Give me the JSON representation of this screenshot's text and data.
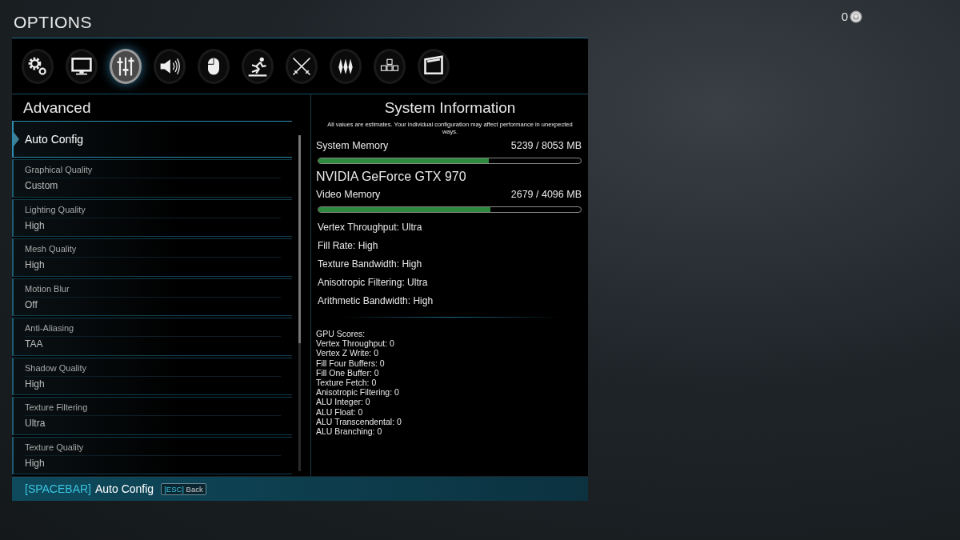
{
  "title": "OPTIONS",
  "currency": {
    "amount": "0"
  },
  "tabs": [
    {
      "kind": "gears",
      "selected": false
    },
    {
      "kind": "monitor",
      "selected": false
    },
    {
      "kind": "sliders",
      "selected": true
    },
    {
      "kind": "speaker",
      "selected": false
    },
    {
      "kind": "mouse",
      "selected": false
    },
    {
      "kind": "runner",
      "selected": false
    },
    {
      "kind": "swords",
      "selected": false
    },
    {
      "kind": "spikes",
      "selected": false
    },
    {
      "kind": "keys",
      "selected": false
    },
    {
      "kind": "screen",
      "selected": false
    }
  ],
  "settings": {
    "heading": "Advanced",
    "items": [
      {
        "kind": "action",
        "label": "Auto Config",
        "selected": true
      },
      {
        "kind": "option",
        "label": "Graphical Quality",
        "value": "Custom",
        "selected": false
      },
      {
        "kind": "option",
        "label": "Lighting Quality",
        "value": "High",
        "selected": false
      },
      {
        "kind": "option",
        "label": "Mesh Quality",
        "value": "High",
        "selected": false
      },
      {
        "kind": "option",
        "label": "Motion Blur",
        "value": "Off",
        "selected": false
      },
      {
        "kind": "option",
        "label": "Anti-Aliasing",
        "value": "TAA",
        "selected": false
      },
      {
        "kind": "option",
        "label": "Shadow Quality",
        "value": "High",
        "selected": false
      },
      {
        "kind": "option",
        "label": "Texture Filtering",
        "value": "Ultra",
        "selected": false
      },
      {
        "kind": "option",
        "label": "Texture Quality",
        "value": "High",
        "selected": false
      }
    ]
  },
  "system_info": {
    "title": "System Information",
    "note": "All values are estimates. Your individual configuration may affect performance in unexpected ways.",
    "system_memory": {
      "label": "System Memory",
      "reading": "5239 / 8053 MB",
      "level": 0.65
    },
    "gpu_name": "NVIDIA GeForce GTX 970",
    "video_memory": {
      "label": "Video Memory",
      "reading": "2679 / 4096 MB",
      "level": 0.654
    },
    "ratings": [
      "Vertex Throughput: Ultra",
      "Fill Rate: High",
      "Texture Bandwidth: High",
      "Anisotropic Filtering: Ultra",
      "Arithmetic Bandwidth: High"
    ],
    "scores": [
      "GPU Scores:",
      "Vertex Throughput: 0",
      "Vertex Z Write: 0",
      "Fill Four Buffers: 0",
      "Fill One Buffer: 0",
      "Texture Fetch: 0",
      "Anisotropic Filtering: 0",
      "ALU Integer: 0",
      "ALU Float: 0",
      "ALU Transcendental: 0",
      "ALU Branching: 0"
    ]
  },
  "footer": {
    "hint_key": "[SPACEBAR]",
    "hint_action": "Auto Config",
    "back_key": "[ESC]",
    "back_label": "Back"
  }
}
